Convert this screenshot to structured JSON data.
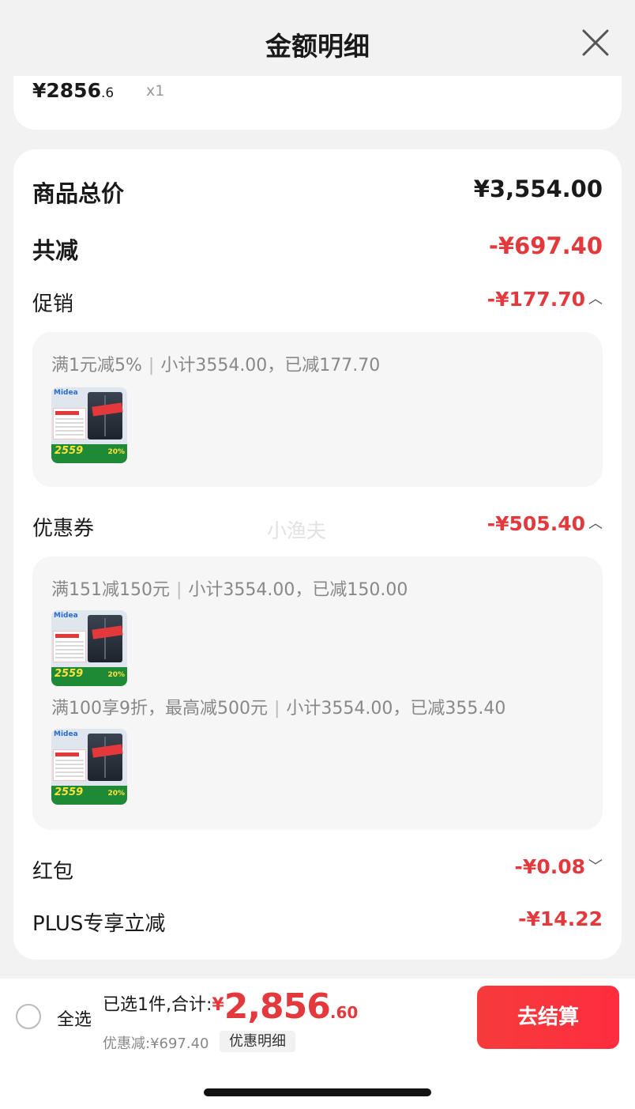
{
  "header": {
    "title": "金额明细",
    "close_icon": "close-icon"
  },
  "item": {
    "price_main": "¥2856",
    "price_dec": ".6",
    "qty": "x1"
  },
  "summary": {
    "total_label": "商品总价",
    "total_value": "¥3,554.00",
    "reduce_label": "共减",
    "reduce_value": "-¥697.40"
  },
  "promotion": {
    "label": "促销",
    "value": "-¥177.70",
    "chevron": "︿",
    "rule": "满1元减5%",
    "subtotal": "小计3554.00，已减177.70",
    "thumb": {
      "brand": "Midea",
      "price": "2559",
      "percent": "20%"
    }
  },
  "coupon": {
    "label": "优惠券",
    "value": "-¥505.40",
    "chevron": "︿",
    "items": [
      {
        "rule": "满151减150元",
        "subtotal": "小计3554.00，已减150.00"
      },
      {
        "rule": "满100享9折，最高减500元",
        "subtotal": "小计3554.00，已减355.40"
      }
    ],
    "thumb": {
      "brand": "Midea",
      "price": "2559",
      "percent": "20%"
    }
  },
  "watermark": "小渔夫",
  "red_packet": {
    "label": "红包",
    "value": "-¥0.08",
    "chevron": "﹀"
  },
  "plus": {
    "label": "PLUS专享立减",
    "value": "-¥14.22"
  },
  "bottom": {
    "select_all": "全选",
    "selected_text": "已选1件,合计:",
    "currency": "¥",
    "total_int": "2,856",
    "total_dec": ".60",
    "discount_text": "优惠减:¥697.40",
    "discount_button": "优惠明细",
    "checkout": "去结算"
  },
  "colors": {
    "accent_red": "#e4393c",
    "background": "#f2f2f2"
  }
}
